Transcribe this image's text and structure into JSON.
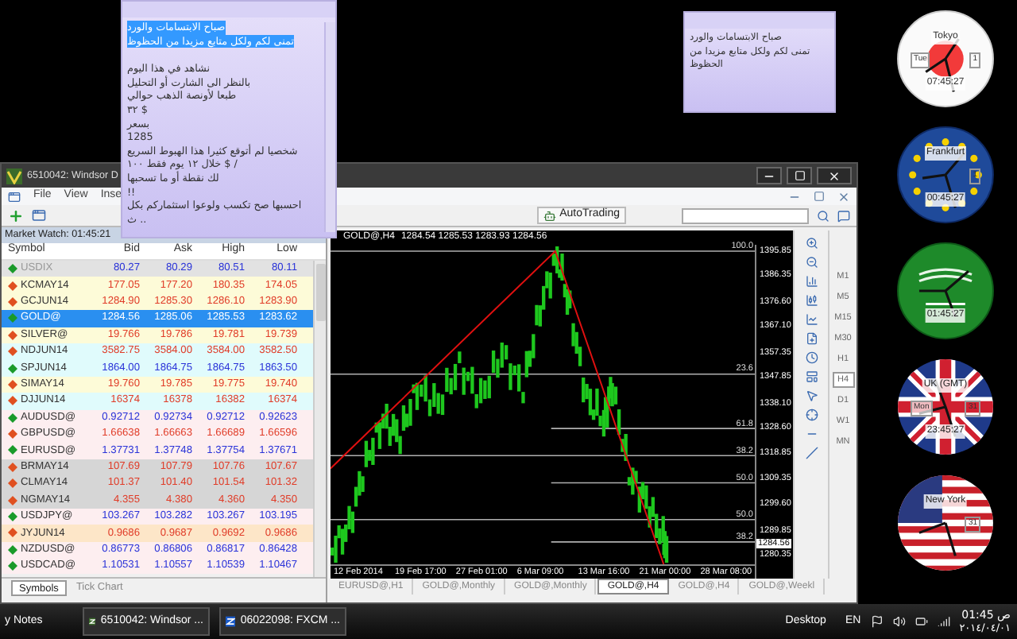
{
  "sticky_notes": [
    {
      "lines": [
        {
          "text": "صباح الابتسامات والورد",
          "highlighted": true
        },
        {
          "text": "تمنى لكم ولكل متابع مزيدا من الحظوظ",
          "highlighted": true
        },
        {
          "text": "نشاهد في هذا اليوم",
          "highlighted": false
        },
        {
          "text": "بالنظر الى الشارت أو التحليل",
          "highlighted": false
        },
        {
          "text": "طبعا لأونصة الذهب حوالي",
          "highlighted": false
        },
        {
          "text": "٣٢ $",
          "highlighted": false
        },
        {
          "text": "بسعر",
          "highlighted": false
        },
        {
          "text": "1285",
          "highlighted": false
        },
        {
          "text": "شخصيا لم أتوقع كثيرا هذا الهبوط السريع",
          "highlighted": false
        },
        {
          "text": "خلال ١٢ يوم فقط ١٠٠ $ /",
          "highlighted": false
        },
        {
          "text": "لك نقطة أو ما تسحبها",
          "highlighted": false
        },
        {
          "text": "!!",
          "highlighted": false
        },
        {
          "text": "احسبها صح تكسب ولوعوا استثماركم بكل",
          "highlighted": false
        },
        {
          "text": "ث ..",
          "highlighted": false
        }
      ]
    },
    {
      "lines": [
        {
          "text": "صباح الابتسامات والورد",
          "highlighted": false
        },
        {
          "text": "تمنى لكم ولكل متابع مزيدا من",
          "highlighted": false
        },
        {
          "text": "الحظوظ",
          "highlighted": false
        }
      ]
    }
  ],
  "trading_window": {
    "title": "6510042: Windsor D",
    "menu": [
      "File",
      "View",
      "Inse"
    ],
    "autotrading": "AutoTrading",
    "market_watch": {
      "title": "Market Watch: 01:45:21",
      "columns": [
        "Symbol",
        "Bid",
        "Ask",
        "High",
        "Low"
      ],
      "rows": [
        {
          "symbol": "USDIX",
          "bid": "80.27",
          "ask": "80.29",
          "high": "80.51",
          "low": "80.11",
          "kind": "up",
          "color": "#e2e2e2",
          "disabled": true,
          "selected": false
        },
        {
          "symbol": "KCMAY14",
          "bid": "177.05",
          "ask": "177.20",
          "high": "180.35",
          "low": "174.05",
          "kind": "down",
          "color": "#fdfbd8",
          "disabled": false,
          "selected": false
        },
        {
          "symbol": "GCJUN14",
          "bid": "1284.90",
          "ask": "1285.30",
          "high": "1286.10",
          "low": "1283.90",
          "kind": "down",
          "color": "#fdfbd8",
          "disabled": false,
          "selected": false
        },
        {
          "symbol": "GOLD@",
          "bid": "1284.56",
          "ask": "1285.06",
          "high": "1285.53",
          "low": "1283.62",
          "kind": "up",
          "disabled": false,
          "selected": true
        },
        {
          "symbol": "SILVER@",
          "bid": "19.766",
          "ask": "19.786",
          "high": "19.781",
          "low": "19.739",
          "kind": "down",
          "color": "#fdfbd8",
          "disabled": false,
          "selected": false
        },
        {
          "symbol": "NDJUN14",
          "bid": "3582.75",
          "ask": "3584.00",
          "high": "3584.00",
          "low": "3582.50",
          "kind": "down",
          "color": "#e0fbfc",
          "disabled": false,
          "selected": false
        },
        {
          "symbol": "SPJUN14",
          "bid": "1864.00",
          "ask": "1864.75",
          "high": "1864.75",
          "low": "1863.50",
          "kind": "up",
          "color": "#e0fbfc",
          "disabled": false,
          "selected": false
        },
        {
          "symbol": "SIMAY14",
          "bid": "19.760",
          "ask": "19.785",
          "high": "19.775",
          "low": "19.740",
          "kind": "down",
          "color": "#fdfbd8",
          "disabled": false,
          "selected": false
        },
        {
          "symbol": "DJJUN14",
          "bid": "16374",
          "ask": "16378",
          "high": "16382",
          "low": "16374",
          "kind": "down",
          "color": "#e0fbfc",
          "disabled": false,
          "selected": false
        },
        {
          "symbol": "AUDUSD@",
          "bid": "0.92712",
          "ask": "0.92734",
          "high": "0.92712",
          "low": "0.92623",
          "kind": "up",
          "color": "#fdeef0",
          "disabled": false,
          "selected": false
        },
        {
          "symbol": "GBPUSD@",
          "bid": "1.66638",
          "ask": "1.66663",
          "high": "1.66689",
          "low": "1.66596",
          "kind": "down",
          "color": "#fdeef0",
          "disabled": false,
          "selected": false
        },
        {
          "symbol": "EURUSD@",
          "bid": "1.37731",
          "ask": "1.37748",
          "high": "1.37754",
          "low": "1.37671",
          "kind": "up",
          "color": "#fdeef0",
          "disabled": false,
          "selected": false
        },
        {
          "symbol": "BRMAY14",
          "bid": "107.69",
          "ask": "107.79",
          "high": "107.76",
          "low": "107.67",
          "kind": "down",
          "color": "#d6d6d6",
          "disabled": false,
          "selected": false
        },
        {
          "symbol": "CLMAY14",
          "bid": "101.37",
          "ask": "101.40",
          "high": "101.54",
          "low": "101.32",
          "kind": "down",
          "color": "#d6d6d6",
          "disabled": false,
          "selected": false
        },
        {
          "symbol": "NGMAY14",
          "bid": "4.355",
          "ask": "4.380",
          "high": "4.360",
          "low": "4.350",
          "kind": "down",
          "color": "#d6d6d6",
          "disabled": false,
          "selected": false
        },
        {
          "symbol": "USDJPY@",
          "bid": "103.267",
          "ask": "103.282",
          "high": "103.267",
          "low": "103.195",
          "kind": "up",
          "color": "#fdeef0",
          "disabled": false,
          "selected": false
        },
        {
          "symbol": "JYJUN14",
          "bid": "0.9686",
          "ask": "0.9687",
          "high": "0.9692",
          "low": "0.9686",
          "kind": "down",
          "color": "#fde6c8",
          "disabled": false,
          "selected": false
        },
        {
          "symbol": "NZDUSD@",
          "bid": "0.86773",
          "ask": "0.86806",
          "high": "0.86817",
          "low": "0.86428",
          "kind": "up",
          "color": "#fdeef0",
          "disabled": false,
          "selected": false
        },
        {
          "symbol": "USDCAD@",
          "bid": "1.10531",
          "ask": "1.10557",
          "high": "1.10539",
          "low": "1.10467",
          "kind": "up",
          "color": "#fdeef0",
          "disabled": false,
          "selected": false
        }
      ],
      "tabs": [
        {
          "label": "Symbols",
          "selected": true
        },
        {
          "label": "Tick Chart",
          "selected": false
        }
      ]
    },
    "chart": {
      "symbol": "GOLD@,H4",
      "ohlc": "1284.54 1285.53 1283.93 1284.56",
      "price_labels": [
        "1395.85",
        "1386.35",
        "1376.60",
        "1367.10",
        "1357.35",
        "1347.85",
        "1338.10",
        "1328.60",
        "1318.85",
        "1309.35",
        "1299.60",
        "1289.85",
        "1280.35"
      ],
      "date_labels": [
        "12 Feb 2014",
        "19 Feb 17:00",
        "27 Feb 01:00",
        "6 Mar 09:00",
        "13 Mar 16:00",
        "21 Mar 00:00",
        "28 Mar 08:00"
      ],
      "current_price": "1284.56",
      "fib_labels": [
        "100.0",
        "23.6",
        "61.8",
        "38.2",
        "50.0",
        "50.0",
        "38.2"
      ]
    },
    "chart_tabs": [
      {
        "label": "EURUSD@,H1",
        "selected": false
      },
      {
        "label": "GOLD@,Monthly",
        "selected": false
      },
      {
        "label": "GOLD@,Monthly",
        "selected": false
      },
      {
        "label": "GOLD@,H4",
        "selected": true
      },
      {
        "label": "GOLD@,H4",
        "selected": false
      },
      {
        "label": "GOLD@,Weekl",
        "selected": false
      }
    ],
    "timeframes": [
      {
        "label": "M1",
        "selected": false
      },
      {
        "label": "M5",
        "selected": false
      },
      {
        "label": "M15",
        "selected": false
      },
      {
        "label": "M30",
        "selected": false
      },
      {
        "label": "H1",
        "selected": false
      },
      {
        "label": "H4",
        "selected": true
      },
      {
        "label": "D1",
        "selected": false
      },
      {
        "label": "W1",
        "selected": false
      },
      {
        "label": "MN",
        "selected": false
      }
    ]
  },
  "clocks": [
    {
      "kind": "white",
      "city": "Tokyo",
      "time": "07:45:27",
      "day": "Tue",
      "date": "1"
    },
    {
      "kind": "stars",
      "city": "Frankfurt",
      "time": "00:45:27",
      "date": "1"
    },
    {
      "kind": "green",
      "time": "01:45:27"
    },
    {
      "kind": "cross",
      "city": "UK (GMT)",
      "time": "23:45:27",
      "day": "Mon",
      "date": "31"
    },
    {
      "kind": "stripes",
      "city": "New York",
      "date": "31"
    }
  ],
  "taskbar": {
    "items": [
      "y Notes",
      "6510042: Windsor ...",
      "06022098: FXCM ..."
    ],
    "desktop": "Desktop",
    "language": "EN",
    "time": "01:45 ص",
    "date": "٢٠١٤/٠٤/٠١"
  }
}
